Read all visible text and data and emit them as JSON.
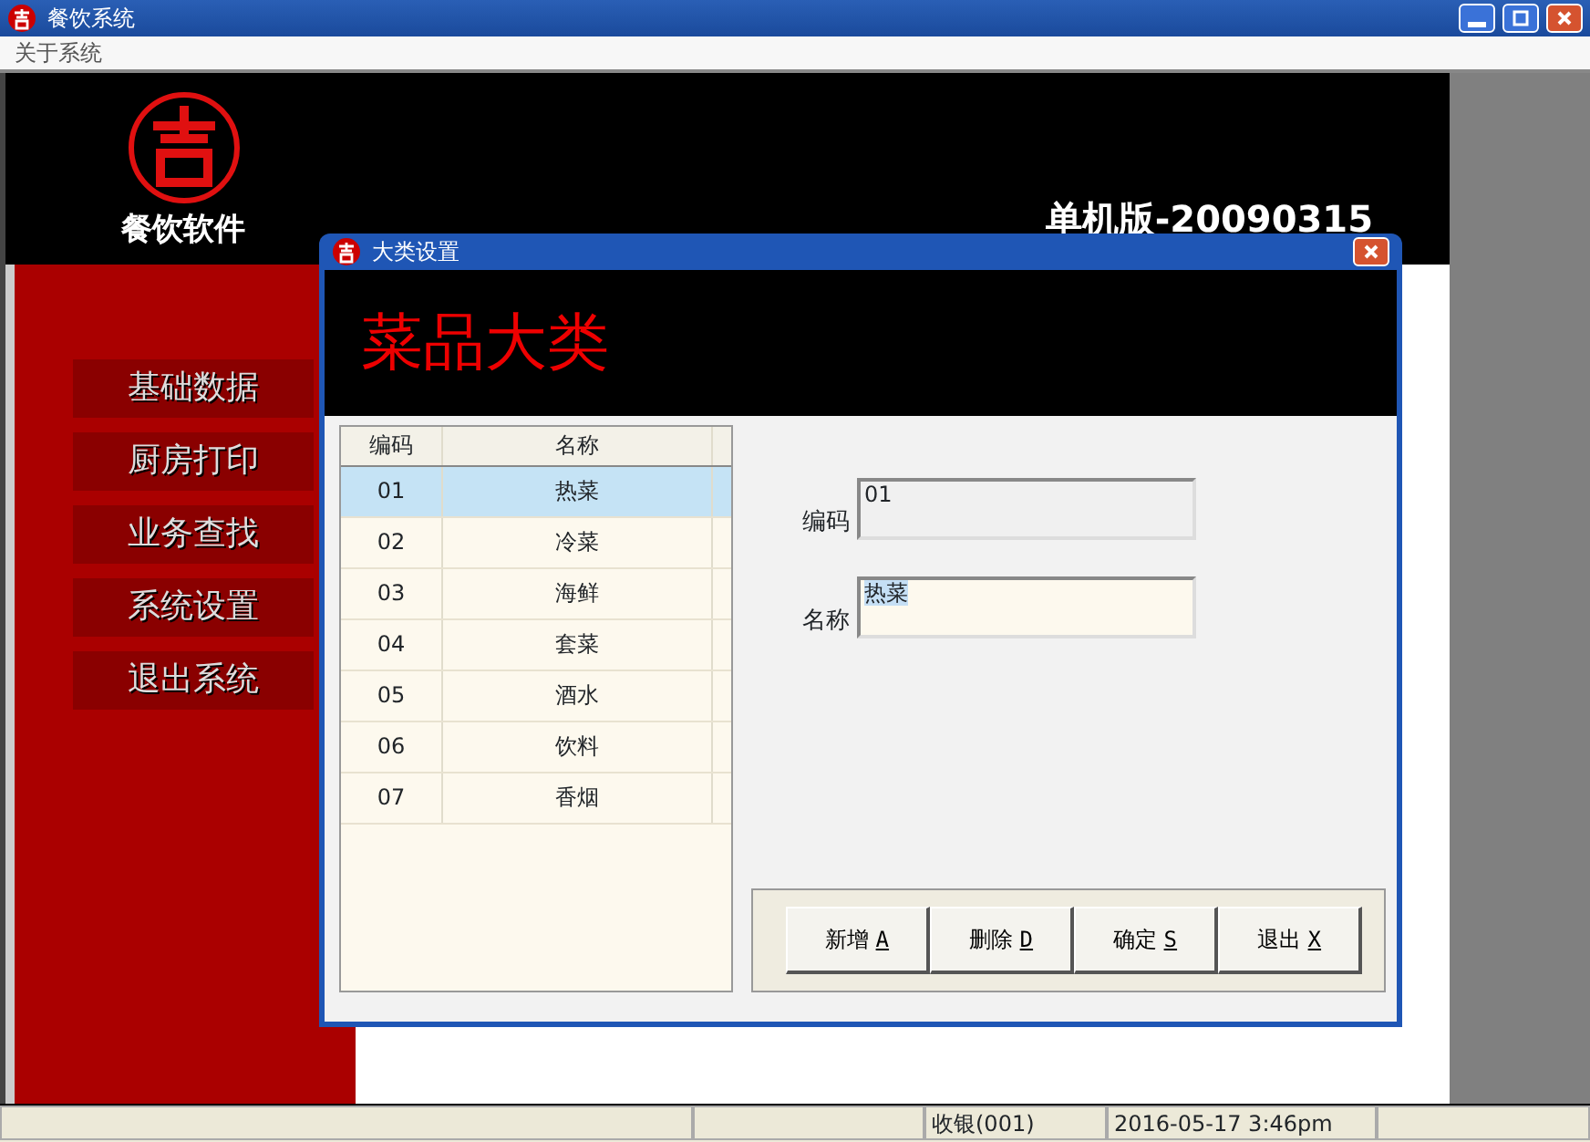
{
  "window": {
    "title": "餐饮系统"
  },
  "menu": [
    "关于系统"
  ],
  "brand": {
    "name": "餐饮软件",
    "version": "单机版-20090315"
  },
  "sidebar": {
    "items": [
      {
        "label": "基础数据"
      },
      {
        "label": "厨房打印"
      },
      {
        "label": "业务查找"
      },
      {
        "label": "系统设置"
      },
      {
        "label": "退出系统"
      }
    ]
  },
  "dialog": {
    "title": "大类设置",
    "heading": "菜品大类",
    "table": {
      "columns": [
        "编码",
        "名称"
      ],
      "rows": [
        {
          "cells": [
            "01",
            "热菜"
          ],
          "selected": true
        },
        {
          "cells": [
            "02",
            "冷菜"
          ],
          "selected": false
        },
        {
          "cells": [
            "03",
            "海鲜"
          ],
          "selected": false
        },
        {
          "cells": [
            "04",
            "套菜"
          ],
          "selected": false
        },
        {
          "cells": [
            "05",
            "酒水"
          ],
          "selected": false
        },
        {
          "cells": [
            "06",
            "饮料"
          ],
          "selected": false
        },
        {
          "cells": [
            "07",
            "香烟"
          ],
          "selected": false
        }
      ]
    },
    "fields": [
      {
        "label": "编码",
        "value": "01",
        "editable": false
      },
      {
        "label": "名称",
        "value": "热菜",
        "editable": true
      }
    ],
    "buttons": [
      {
        "label": "新增",
        "key": "A"
      },
      {
        "label": "删除",
        "key": "D"
      },
      {
        "label": "确定",
        "key": "S"
      },
      {
        "label": "退出",
        "key": "X"
      }
    ]
  },
  "status_bar": [
    "收银(001)",
    "2016-05-17 3:46pm"
  ]
}
